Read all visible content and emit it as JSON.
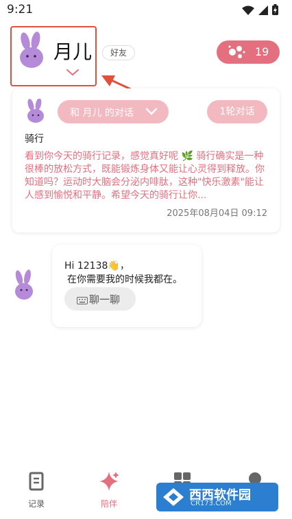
{
  "status_bar": {
    "time": "9:21",
    "icons": [
      "wifi-icon",
      "signal-icon",
      "battery-icon"
    ]
  },
  "header": {
    "name": "月儿",
    "tag": "好友",
    "points": "19",
    "avatar_icon": "bunny-avatar-icon"
  },
  "conversation_card": {
    "pill_label": "和 月儿 的对话",
    "rounds_label": "1轮对话",
    "topic": "骑行",
    "message": "看到你今天的骑行记录，感觉真好呢 🌿 骑行确实是一种很棒的放松方式，既能锻炼身体又能让心灵得到释放。你知道吗？运动时大脑会分泌内啡肽，这种\"快乐激素\"能让人感到愉悦和平静。希望今天的骑行让你...",
    "date": "2025年08月04日 09:12"
  },
  "greeting": {
    "line1": "Hi 12138👋，",
    "line2": "在你需要我的时候我都在。",
    "button_label": "聊一聊"
  },
  "bottom_nav": {
    "items": [
      {
        "label": "记录",
        "icon": "record-icon"
      },
      {
        "label": "陪伴",
        "icon": "sparkle-icon"
      },
      {
        "label": "",
        "icon": "grid-icon"
      },
      {
        "label": "",
        "icon": "bulb-icon"
      }
    ]
  },
  "watermark": {
    "main": "西西软件园",
    "sub": "CR173.COM"
  },
  "colors": {
    "accent_pink": "#e36f7f",
    "light_pink": "#f2b9c0",
    "annotation_red": "#e0503a",
    "avatar_purple": "#b58ad8"
  }
}
